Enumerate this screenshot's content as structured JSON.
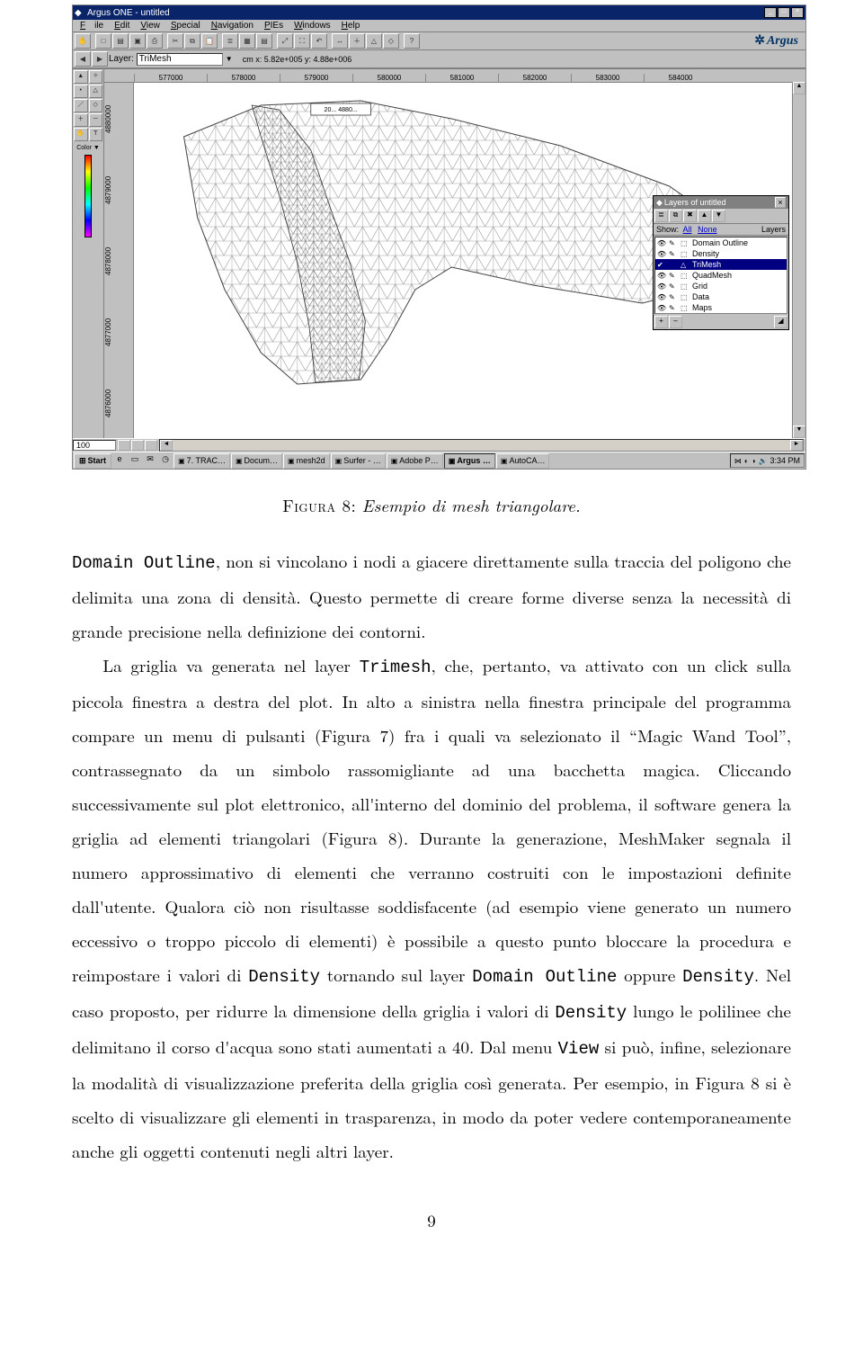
{
  "app": {
    "title": "Argus ONE - untitled",
    "menus": [
      "File",
      "Edit",
      "View",
      "Special",
      "Navigation",
      "PIEs",
      "Windows",
      "Help"
    ],
    "layer_label": "Layer:",
    "layer_value": "TriMesh",
    "coord": "cm x: 5.82e+005  y: 4.88e+006",
    "logo": "Argus",
    "ruler_x": [
      "577000",
      "578000",
      "579000",
      "580000",
      "581000",
      "582000",
      "583000",
      "584000"
    ],
    "ruler_y": [
      "4880000",
      "4879000",
      "4878000",
      "4877000",
      "4876000"
    ],
    "zoom": "100"
  },
  "layers_panel": {
    "title": "Layers of untitled",
    "show_label": "Show:",
    "show_all": "All",
    "show_none": "None",
    "col_layers": "Layers",
    "rows": [
      {
        "name": "Domain Outline",
        "sel": false
      },
      {
        "name": "Density",
        "sel": false
      },
      {
        "name": "TriMesh",
        "sel": true
      },
      {
        "name": "QuadMesh",
        "sel": false
      },
      {
        "name": "Grid",
        "sel": false
      },
      {
        "name": "Data",
        "sel": false
      },
      {
        "name": "Maps",
        "sel": false
      }
    ]
  },
  "taskbar": {
    "start": "Start",
    "buttons": [
      "7. TRAC…",
      "Docum…",
      "mesh2d",
      "Surfer - …",
      "Adobe P…",
      "Argus …",
      "AutoCA…"
    ],
    "active_index": 5,
    "time": "3:34 PM"
  },
  "caption": {
    "label": "Figura 8:",
    "text": "Esempio di mesh triangolare."
  },
  "body": {
    "p1a": "Domain Outline",
    "p1b": ", non si vincolano i nodi a giacere direttamente sulla traccia del poligono che delimita una zona di densità. Questo permette di creare forme diverse senza la necessità di grande precisione nella definizione dei contorni.",
    "p2a": "La griglia va generata nel layer ",
    "p2b": "Trimesh",
    "p2c": ", che, pertanto, va attivato con un click sulla piccola finestra a destra del plot. In alto a sinistra nella finestra principale del programma compare un menu di pulsanti (Figura 7) fra i quali va selezionato il “Magic Wand Tool”, contrassegnato da un simbolo rassomigliante ad una bacchetta magica. Cliccando successivamente sul plot elettronico, all'interno del dominio del problema, il software genera la griglia ad elementi triangolari (Figura 8). Durante la generazione, MeshMaker segnala il numero approssimativo di elementi che verranno costruiti con le impostazioni definite dall'utente. Qualora ciò non risultasse soddisfacente (ad esempio viene generato un numero eccessivo o troppo piccolo di elementi) è possibile a questo punto bloccare la procedura e reimpostare i valori di ",
    "p2d": "Density",
    "p2e": " tornando sul layer ",
    "p2f": "Domain Outline",
    "p2g": " oppure ",
    "p2h": "Density",
    "p2i": ". Nel caso proposto, per ridurre la dimensione della griglia i valori di ",
    "p2j": "Density",
    "p2k": " lungo le polilinee che delimitano il corso d'acqua sono stati aumentati a 40. Dal menu ",
    "p2l": "View",
    "p2m": " si può, infine, selezionare la modalità di visualizzazione preferita della griglia così generata. Per esempio, in Figura 8 si è scelto di visualizzare gli elementi in trasparenza, in modo da poter vedere contemporaneamente anche gli oggetti contenuti negli altri layer."
  },
  "page_number": "9"
}
